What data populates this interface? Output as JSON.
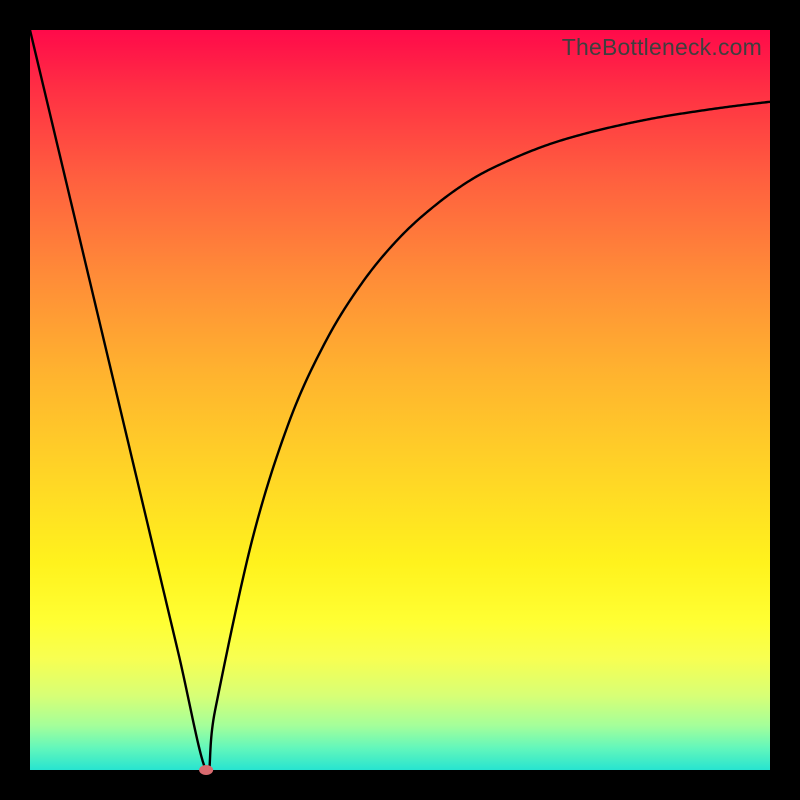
{
  "attribution": "TheBottleneck.com",
  "chart_data": {
    "type": "line",
    "title": "",
    "xlabel": "",
    "ylabel": "",
    "xlim": [
      0,
      100
    ],
    "ylim": [
      0,
      100
    ],
    "series": [
      {
        "name": "bottleneck-curve",
        "x": [
          0,
          5,
          10,
          15,
          20,
          23.8,
          25,
          30,
          35,
          40,
          45,
          50,
          55,
          60,
          65,
          70,
          75,
          80,
          85,
          90,
          95,
          100
        ],
        "values": [
          100,
          79,
          58,
          37,
          16,
          0,
          8,
          31,
          47,
          58,
          66,
          72,
          76.5,
          80,
          82.5,
          84.5,
          86,
          87.2,
          88.2,
          89,
          89.7,
          90.3
        ]
      }
    ],
    "markers": [
      {
        "name": "selected-point",
        "x": 23.8,
        "y": 0,
        "color": "#d96a6f"
      }
    ],
    "background_gradient": {
      "top": "#ff0a4a",
      "bottom": "#27e4d0"
    },
    "frame_color": "#000000"
  }
}
